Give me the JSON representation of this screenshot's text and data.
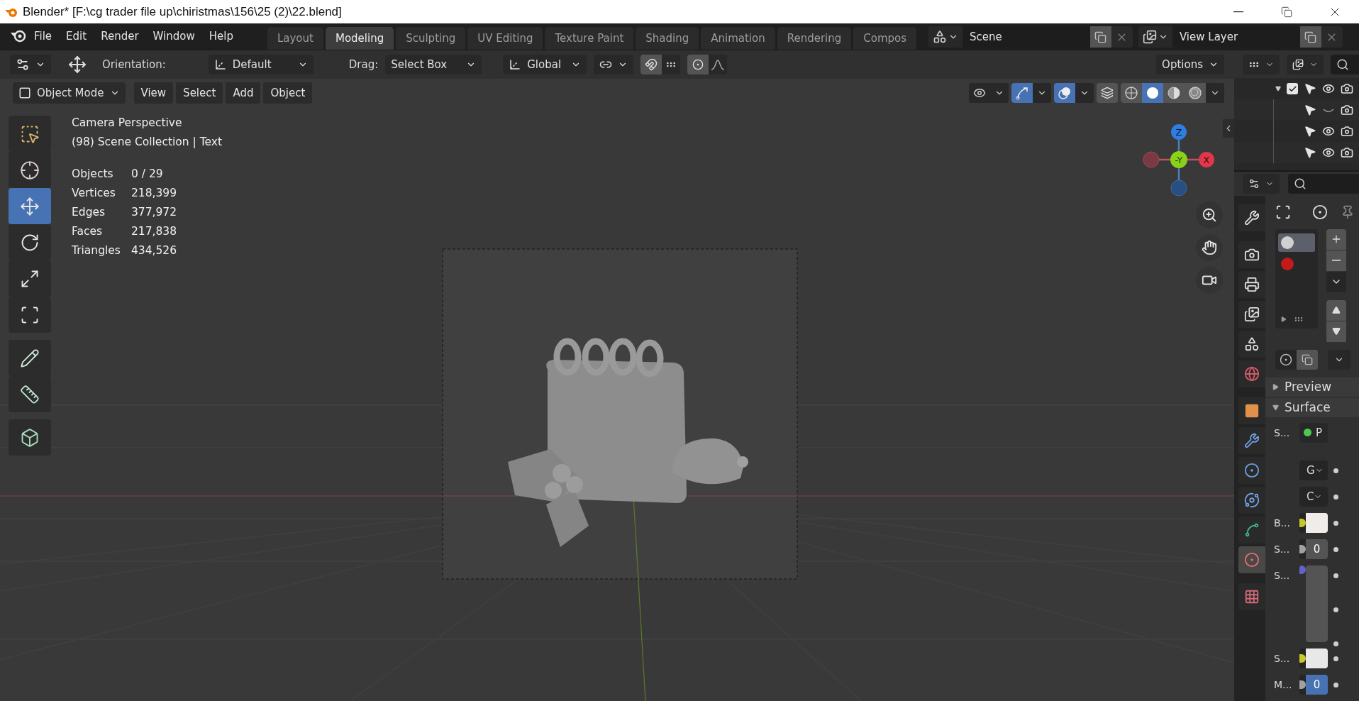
{
  "window": {
    "title": "Blender* [F:\\cg trader file up\\chiristmas\\156\\25 (2)\\22.blend]"
  },
  "menu": [
    "File",
    "Edit",
    "Render",
    "Window",
    "Help"
  ],
  "workspaces": [
    {
      "label": "Layout",
      "selected": false
    },
    {
      "label": "Modeling",
      "selected": true
    },
    {
      "label": "Sculpting",
      "selected": false
    },
    {
      "label": "UV Editing",
      "selected": false
    },
    {
      "label": "Texture Paint",
      "selected": false
    },
    {
      "label": "Shading",
      "selected": false
    },
    {
      "label": "Animation",
      "selected": false
    },
    {
      "label": "Rendering",
      "selected": false
    },
    {
      "label": "Compos",
      "selected": false
    }
  ],
  "scene": "Scene",
  "view_layer": "View Layer",
  "tool_header": {
    "orientation_label": "Orientation:",
    "orientation": "Default",
    "drag_label": "Drag:",
    "drag": "Select Box",
    "transform_orientation": "Global",
    "options": "Options"
  },
  "viewport_header": {
    "mode": "Object Mode",
    "menus": [
      "View",
      "Select",
      "Add",
      "Object"
    ],
    "gizmos": true,
    "overlays": true,
    "xray": false,
    "shading": [
      {
        "kind": "wireframe",
        "selected": false
      },
      {
        "kind": "solid",
        "selected": true
      },
      {
        "kind": "material",
        "selected": false
      },
      {
        "kind": "rendered",
        "selected": false
      }
    ]
  },
  "tools": [
    {
      "kind": "select",
      "selected": false
    },
    {
      "kind": "cursor",
      "selected": false
    },
    {
      "kind": "move",
      "selected": true
    },
    {
      "kind": "rotate",
      "selected": false
    },
    {
      "kind": "scale",
      "selected": false
    },
    {
      "kind": "transform",
      "selected": false
    },
    {
      "kind": "annotate",
      "selected": false
    },
    {
      "kind": "measure",
      "selected": false
    },
    {
      "kind": "add_cube",
      "selected": false
    }
  ],
  "viewport_info": {
    "view": "Camera Perspective",
    "context": "(98) Scene Collection | Text",
    "stats": [
      {
        "label": "Objects",
        "value": "0 / 29"
      },
      {
        "label": "Vertices",
        "value": "218,399"
      },
      {
        "label": "Edges",
        "value": "377,972"
      },
      {
        "label": "Faces",
        "value": "217,838"
      },
      {
        "label": "Triangles",
        "value": "434,526"
      }
    ]
  },
  "gizmo": {
    "z": "Z",
    "y": "-Y",
    "x": "X"
  },
  "outliner": {
    "rows": [
      {
        "kind": "collection",
        "checked": true,
        "visible": true
      },
      {
        "kind": "object",
        "visible": false
      },
      {
        "kind": "object",
        "visible": true
      },
      {
        "kind": "object",
        "visible": true
      }
    ]
  },
  "properties": {
    "tabs": [
      {
        "kind": "tool",
        "selected": false
      },
      {
        "kind": "render",
        "selected": false
      },
      {
        "kind": "output",
        "selected": false
      },
      {
        "kind": "view_layer",
        "selected": false
      },
      {
        "kind": "scene",
        "selected": false
      },
      {
        "kind": "world",
        "selected": false
      },
      {
        "kind": "object",
        "selected": false
      },
      {
        "kind": "modifiers",
        "selected": false
      },
      {
        "kind": "particles",
        "selected": false
      },
      {
        "kind": "physics",
        "selected": false
      },
      {
        "kind": "data",
        "selected": false
      },
      {
        "kind": "material",
        "selected": true
      },
      {
        "kind": "texture",
        "selected": false
      }
    ],
    "material_slots": [
      {
        "color": "#d0d0d0",
        "selected": true
      },
      {
        "color": "#c41a1a",
        "selected": false
      }
    ],
    "panels": [
      {
        "title": "Preview",
        "expanded": false
      },
      {
        "title": "Surface",
        "expanded": true
      }
    ],
    "fields": [
      {
        "kind": "shader",
        "label": "S...",
        "color": "#4fc84f",
        "value": "P"
      },
      {
        "kind": "dropdown",
        "value": "G"
      },
      {
        "kind": "dropdown",
        "value": "C"
      },
      {
        "kind": "color",
        "label": "B...",
        "color": "#c7c729",
        "swatch": {
          "color": "#efecea"
        }
      },
      {
        "kind": "number",
        "label": "S...",
        "color": "#a1a1a1",
        "value": "0",
        "active": false
      },
      {
        "kind": "vector",
        "label": "S...",
        "color": "#6363c7"
      },
      {
        "kind": "color",
        "label": "S...",
        "color": "#c7c729",
        "swatch": {
          "color": "#e8e8e8"
        }
      },
      {
        "kind": "number",
        "label": "M...",
        "color": "#a1a1a1",
        "value": "0",
        "active": true
      }
    ]
  }
}
